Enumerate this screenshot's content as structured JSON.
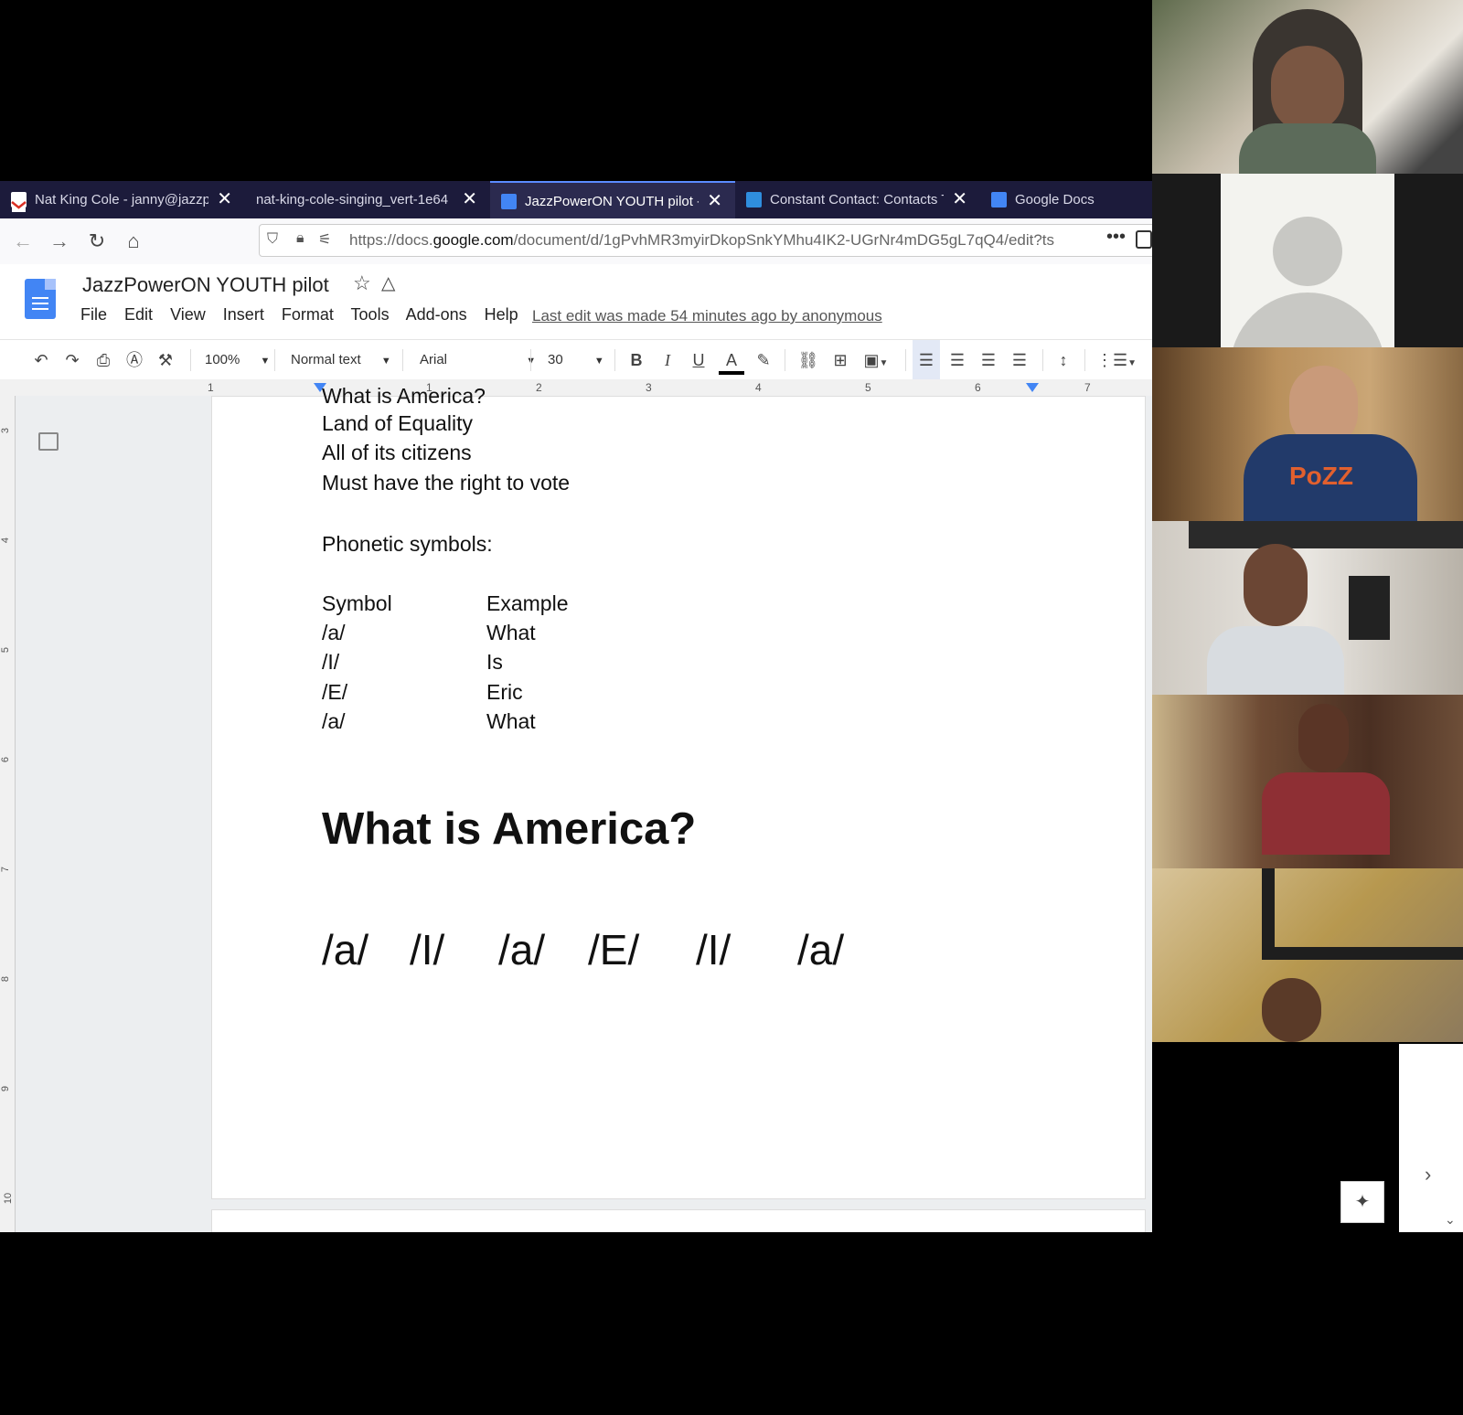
{
  "tabs": [
    {
      "label": "Nat King Cole - janny@jazzp",
      "icon": "gmail-icon",
      "color": "#d93025"
    },
    {
      "label": "nat-king-cole-singing_vert-1e64",
      "icon": "",
      "color": ""
    },
    {
      "label": "JazzPowerON YOUTH pilot - ",
      "icon": "docs-icon",
      "color": "#4285f4"
    },
    {
      "label": "Constant Contact: Contacts T",
      "icon": "constant-contact-icon",
      "color": "#2f8ede"
    },
    {
      "label": "Google Docs",
      "icon": "docs-icon",
      "color": "#4285f4"
    }
  ],
  "url": {
    "prefix": "https://docs.",
    "domain": "google.com",
    "rest": "/document/d/1gPvhMR3myirDkopSnkYMhu4IK2-UGrNr4mDG5gL7qQ4/edit?ts"
  },
  "doc": {
    "title": "JazzPowerON YOUTH pilot",
    "menu": [
      "File",
      "Edit",
      "View",
      "Insert",
      "Format",
      "Tools",
      "Add-ons",
      "Help"
    ],
    "last_edit": "Last edit was made 54 minutes ago by anonymous"
  },
  "toolbar": {
    "zoom": "100%",
    "style": "Normal text",
    "font": "Arial",
    "size": "30"
  },
  "ruler": [
    "1",
    "1",
    "2",
    "3",
    "4",
    "5",
    "6",
    "7"
  ],
  "vruler": [
    "3",
    "4",
    "5",
    "6",
    "7",
    "8",
    "9",
    "10"
  ],
  "body": {
    "cut_line": "What is America?",
    "lines": [
      "Land of Equality",
      "All of its citizens",
      "Must have the right to vote"
    ],
    "phonetic_heading": "Phonetic symbols:",
    "table_header": {
      "symbol": "Symbol",
      "example": "Example"
    },
    "table_rows": [
      {
        "symbol": "/a/",
        "example": "What"
      },
      {
        "symbol": "/I/",
        "example": "Is"
      },
      {
        "symbol": "/E/",
        "example": "Eric"
      },
      {
        "symbol": "/a/",
        "example": "What"
      }
    ],
    "big_title": "What is America?",
    "phonemes": [
      "/a/",
      "/I/",
      "/a/",
      "/E/",
      "/I/",
      "/a/"
    ]
  },
  "participants": [
    {
      "name": "participant-1",
      "color": "#8a7a5c"
    },
    {
      "name": "participant-2",
      "color": "#f3f3ef"
    },
    {
      "name": "participant-3",
      "color": "#9c7547"
    },
    {
      "name": "participant-4",
      "color": "#9a8f88"
    },
    {
      "name": "participant-5",
      "color": "#7d4a3a"
    },
    {
      "name": "participant-6",
      "color": "#a88a52"
    }
  ]
}
